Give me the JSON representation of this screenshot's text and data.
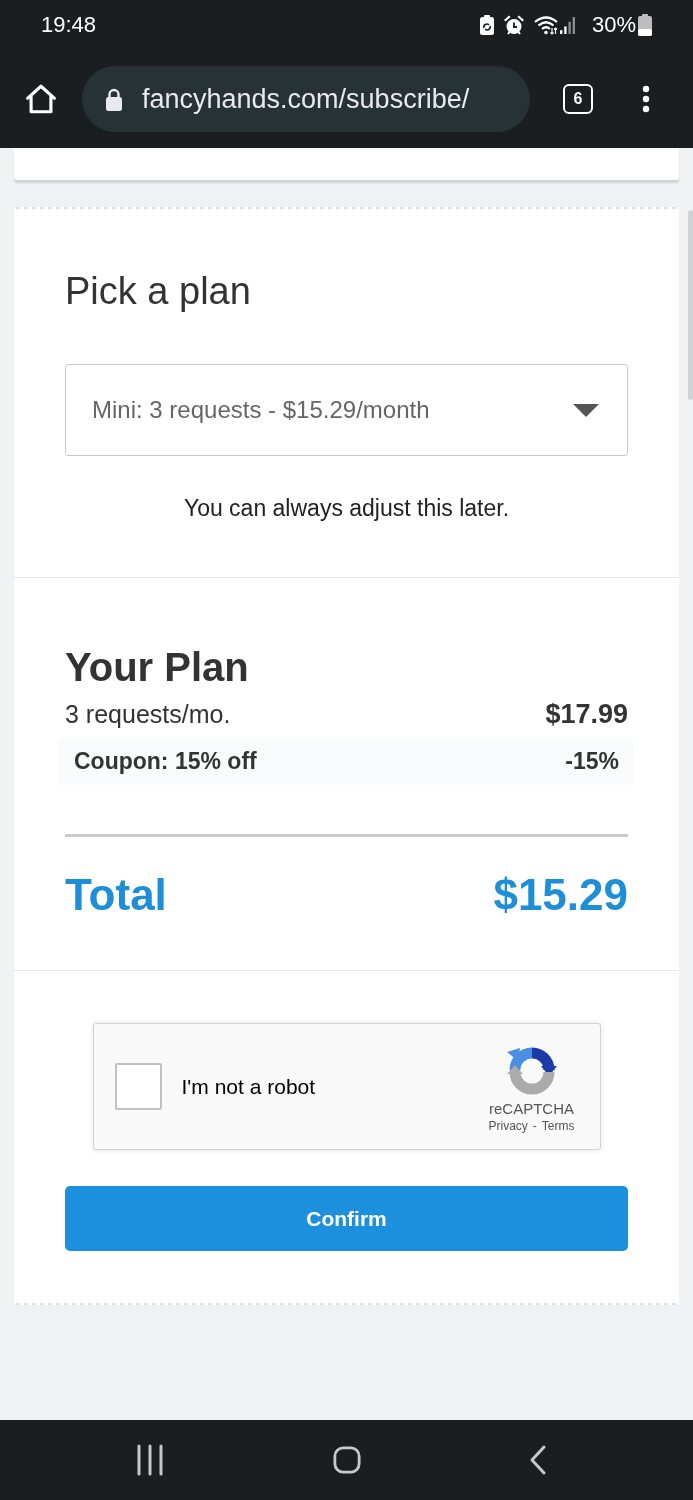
{
  "status_bar": {
    "time": "19:48",
    "battery": "30%"
  },
  "browser_bar": {
    "url": "fancyhands.com/subscribe/",
    "tab_count": "6"
  },
  "plan_picker": {
    "title": "Pick a plan",
    "select": {
      "value": "Mini: 3 requests - $15.29/month"
    },
    "hint": "You can always adjust this later."
  },
  "summary": {
    "title": "Your Plan",
    "lines": [
      {
        "kind": "item",
        "label": "3 requests/mo.",
        "amount": "$17.99"
      },
      {
        "kind": "coupon",
        "label": "Coupon: 15% off",
        "amount": "-15%"
      }
    ],
    "total": {
      "label": "Total",
      "amount": "$15.29"
    }
  },
  "captcha": {
    "checked": false,
    "label": "I'm not a robot",
    "brand": "reCAPTCHA",
    "links": [
      "Privacy",
      "Terms"
    ],
    "separator": "-"
  },
  "confirm_button": {
    "label": "Confirm"
  }
}
